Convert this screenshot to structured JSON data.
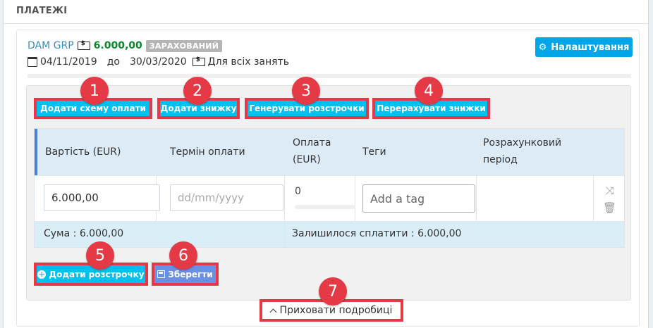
{
  "section": {
    "title": "ПЛАТЕЖІ"
  },
  "contract": {
    "name": "DAM GRP",
    "amount": "6.000,00",
    "status": "ЗАРАХОВАНИЙ",
    "date_from": "04/11/2019",
    "date_sep": "до",
    "date_to": "30/03/2020",
    "scope": "Для всіх занять"
  },
  "settings_button": {
    "label": "Налаштування",
    "icon": "gear-icon"
  },
  "actions": [
    {
      "label": "Додати схему оплати",
      "number": "1"
    },
    {
      "label": "Додати знижку",
      "number": "2"
    },
    {
      "label": "Генерувати розстрочки",
      "number": "3"
    },
    {
      "label": "Перерахувати знижки",
      "number": "4"
    }
  ],
  "table": {
    "headers": {
      "cost": "Вартість (EUR)",
      "due": "Термін оплати",
      "paid_line1": "Оплата",
      "paid_line2": "(EUR)",
      "tags": "Теги",
      "period_line1": "Розрахунковий",
      "period_line2": "період"
    },
    "row": {
      "cost_value": "6.000,00",
      "due_placeholder": "dd/mm/yyyy",
      "paid_value": "0",
      "tags_placeholder": "Add a tag"
    },
    "footer": {
      "sum": "Сума : 6.000,00",
      "remaining": "Залишилося сплатити : 6.000,00"
    }
  },
  "bottom_buttons": {
    "add_installment": {
      "label": "Додати розстрочку",
      "number": "5"
    },
    "save": {
      "label": "Зберегти",
      "number": "6"
    }
  },
  "hide_details": {
    "label": "Приховати подробиці",
    "number": "7"
  },
  "colors": {
    "accent": "#00c0ef",
    "settings": "#00a6e8",
    "highlight": "#e63946",
    "amount": "#0a8a2a",
    "save": "#6a8fe6"
  }
}
